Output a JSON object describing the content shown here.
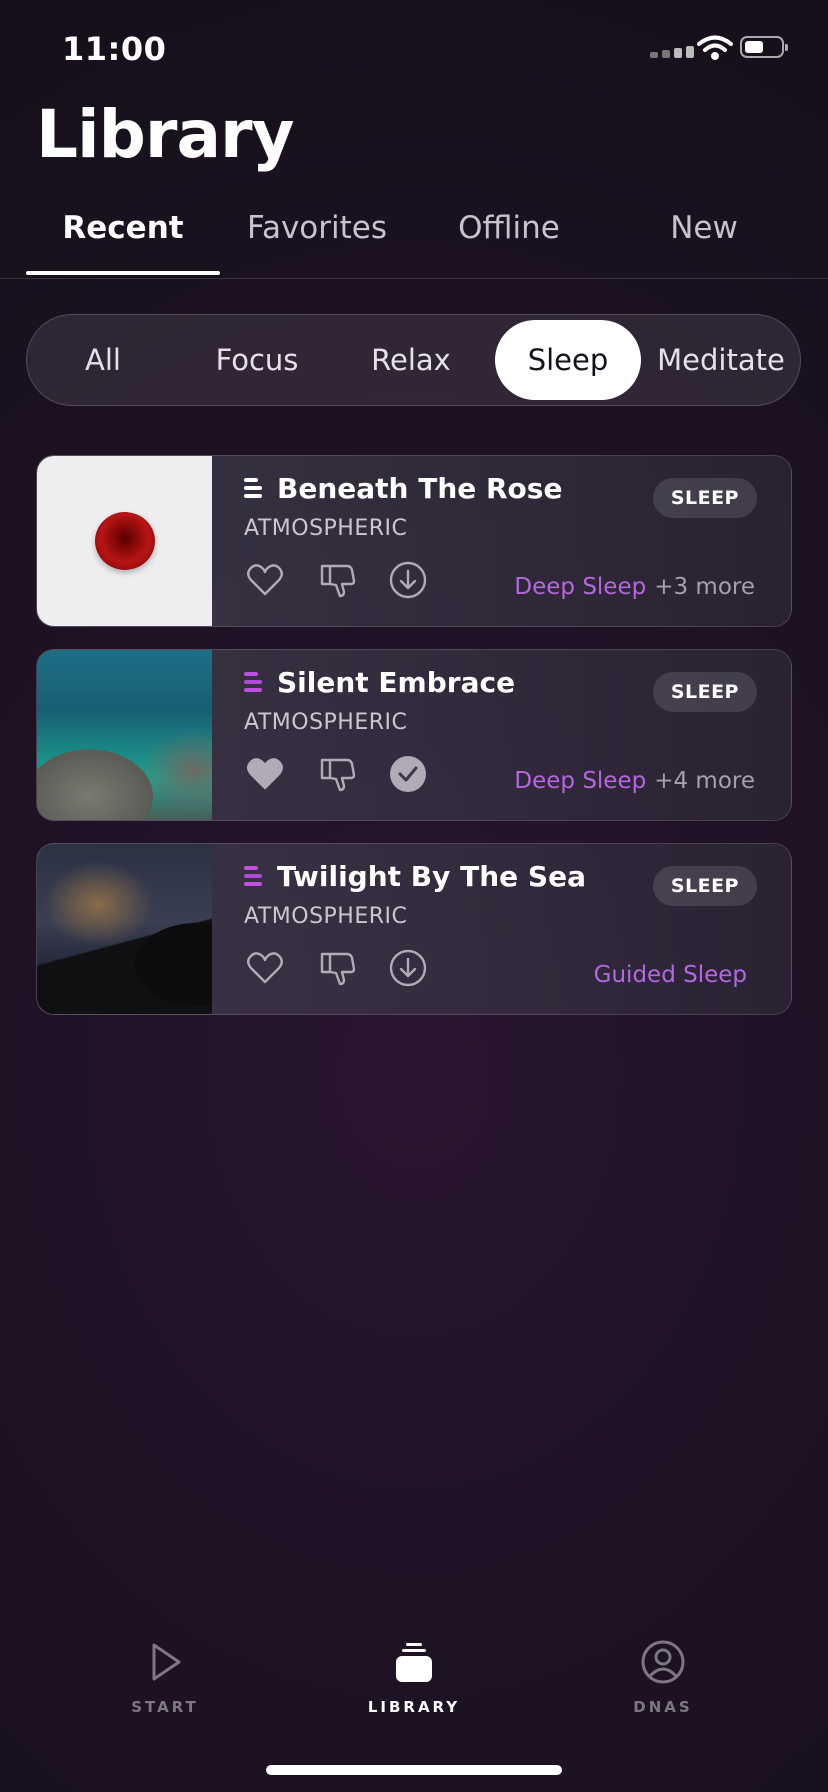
{
  "status_bar": {
    "time": "11:00"
  },
  "header": {
    "title": "Library"
  },
  "tabs": [
    {
      "label": "Recent",
      "active": true
    },
    {
      "label": "Favorites",
      "active": false
    },
    {
      "label": "Offline",
      "active": false
    },
    {
      "label": "New",
      "active": false
    }
  ],
  "filters": [
    {
      "label": "All",
      "active": false
    },
    {
      "label": "Focus",
      "active": false
    },
    {
      "label": "Relax",
      "active": false
    },
    {
      "label": "Sleep",
      "active": true
    },
    {
      "label": "Meditate",
      "active": false
    }
  ],
  "tracks": [
    {
      "title": "Beneath The Rose",
      "genre": "ATMOSPHERIC",
      "badge": "SLEEP",
      "tag": "Deep Sleep",
      "more": "+3 more",
      "liked": false,
      "downloaded": false,
      "icon": "rose-image"
    },
    {
      "title": "Silent Embrace",
      "genre": "ATMOSPHERIC",
      "badge": "SLEEP",
      "tag": "Deep Sleep",
      "more": "+4 more",
      "liked": true,
      "downloaded": true,
      "icon": "sea-image"
    },
    {
      "title": "Twilight By The Sea",
      "genre": "ATMOSPHERIC",
      "badge": "SLEEP",
      "tag": "Guided Sleep",
      "more": "",
      "liked": false,
      "downloaded": false,
      "icon": "night-sky-image"
    }
  ],
  "bottom_nav": [
    {
      "label": "START",
      "icon": "play-icon",
      "active": false
    },
    {
      "label": "LIBRARY",
      "icon": "library-icon",
      "active": true
    },
    {
      "label": "DNAS",
      "icon": "profile-icon",
      "active": false
    }
  ],
  "colors": {
    "accent": "#b567e0",
    "background": "#1e1224",
    "card": "#3a3848"
  }
}
